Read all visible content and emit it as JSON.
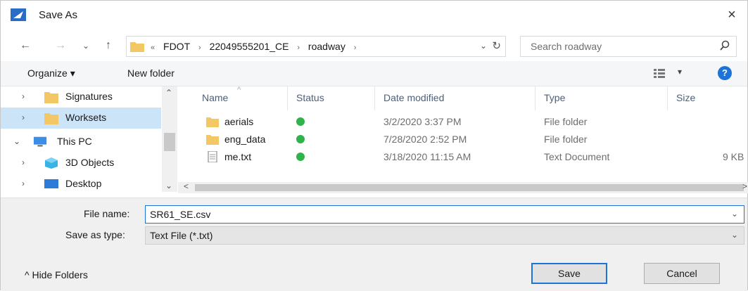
{
  "window": {
    "title": "Save As",
    "close_glyph": "×"
  },
  "nav": {
    "back": "←",
    "forward": "→",
    "recent": "⌄",
    "up": "↑",
    "breadcrumb": [
      "«",
      "FDOT",
      "›",
      "22049555201_CE",
      "›",
      "roadway",
      "›"
    ],
    "dropdown": "⌄",
    "refresh": "↻",
    "search_placeholder": "Search roadway"
  },
  "toolbar": {
    "organize_label": "Organize ▾",
    "new_folder_label": "New folder",
    "help": "?",
    "view_dd": "▾"
  },
  "sidebar": {
    "items": [
      {
        "label": "Signatures",
        "icon": "folder-icon",
        "chevron": "›",
        "selected": false
      },
      {
        "label": "Worksets",
        "icon": "folder-icon",
        "chevron": "›",
        "selected": true
      },
      {
        "label": "This PC",
        "icon": "pc-icon",
        "chevron": "⌄",
        "selected": false
      },
      {
        "label": "3D Objects",
        "icon": "cube-icon",
        "chevron": "›",
        "selected": false
      },
      {
        "label": "Desktop",
        "icon": "desktop-icon",
        "chevron": "›",
        "selected": false
      }
    ],
    "scroll_up": "⌃",
    "scroll_down": "⌄"
  },
  "columns": {
    "name": "Name",
    "status": "Status",
    "date": "Date modified",
    "type": "Type",
    "size": "Size",
    "sort_glyph": "^"
  },
  "files": [
    {
      "name": "aerials",
      "icon": "folder-icon",
      "date": "3/2/2020 3:37 PM",
      "type": "File folder",
      "size": ""
    },
    {
      "name": "eng_data",
      "icon": "folder-icon",
      "date": "7/28/2020 2:52 PM",
      "type": "File folder",
      "size": ""
    },
    {
      "name": "me.txt",
      "icon": "text-file-icon",
      "date": "3/18/2020 11:15 AM",
      "type": "Text Document",
      "size": "9 KB"
    }
  ],
  "hscroll": {
    "left": "<",
    "right": ">"
  },
  "form": {
    "file_name_label": "File name:",
    "file_name_value": "SR61_SE.csv",
    "save_type_label": "Save as type:",
    "save_type_value": "Text File (*.txt)",
    "dd": "⌄"
  },
  "footer": {
    "hide_folders": "^  Hide Folders",
    "save": "Save",
    "cancel": "Cancel"
  },
  "colors": {
    "accent": "#1e74d6",
    "folder": "#f3c766",
    "status_ok": "#2fb34a"
  }
}
